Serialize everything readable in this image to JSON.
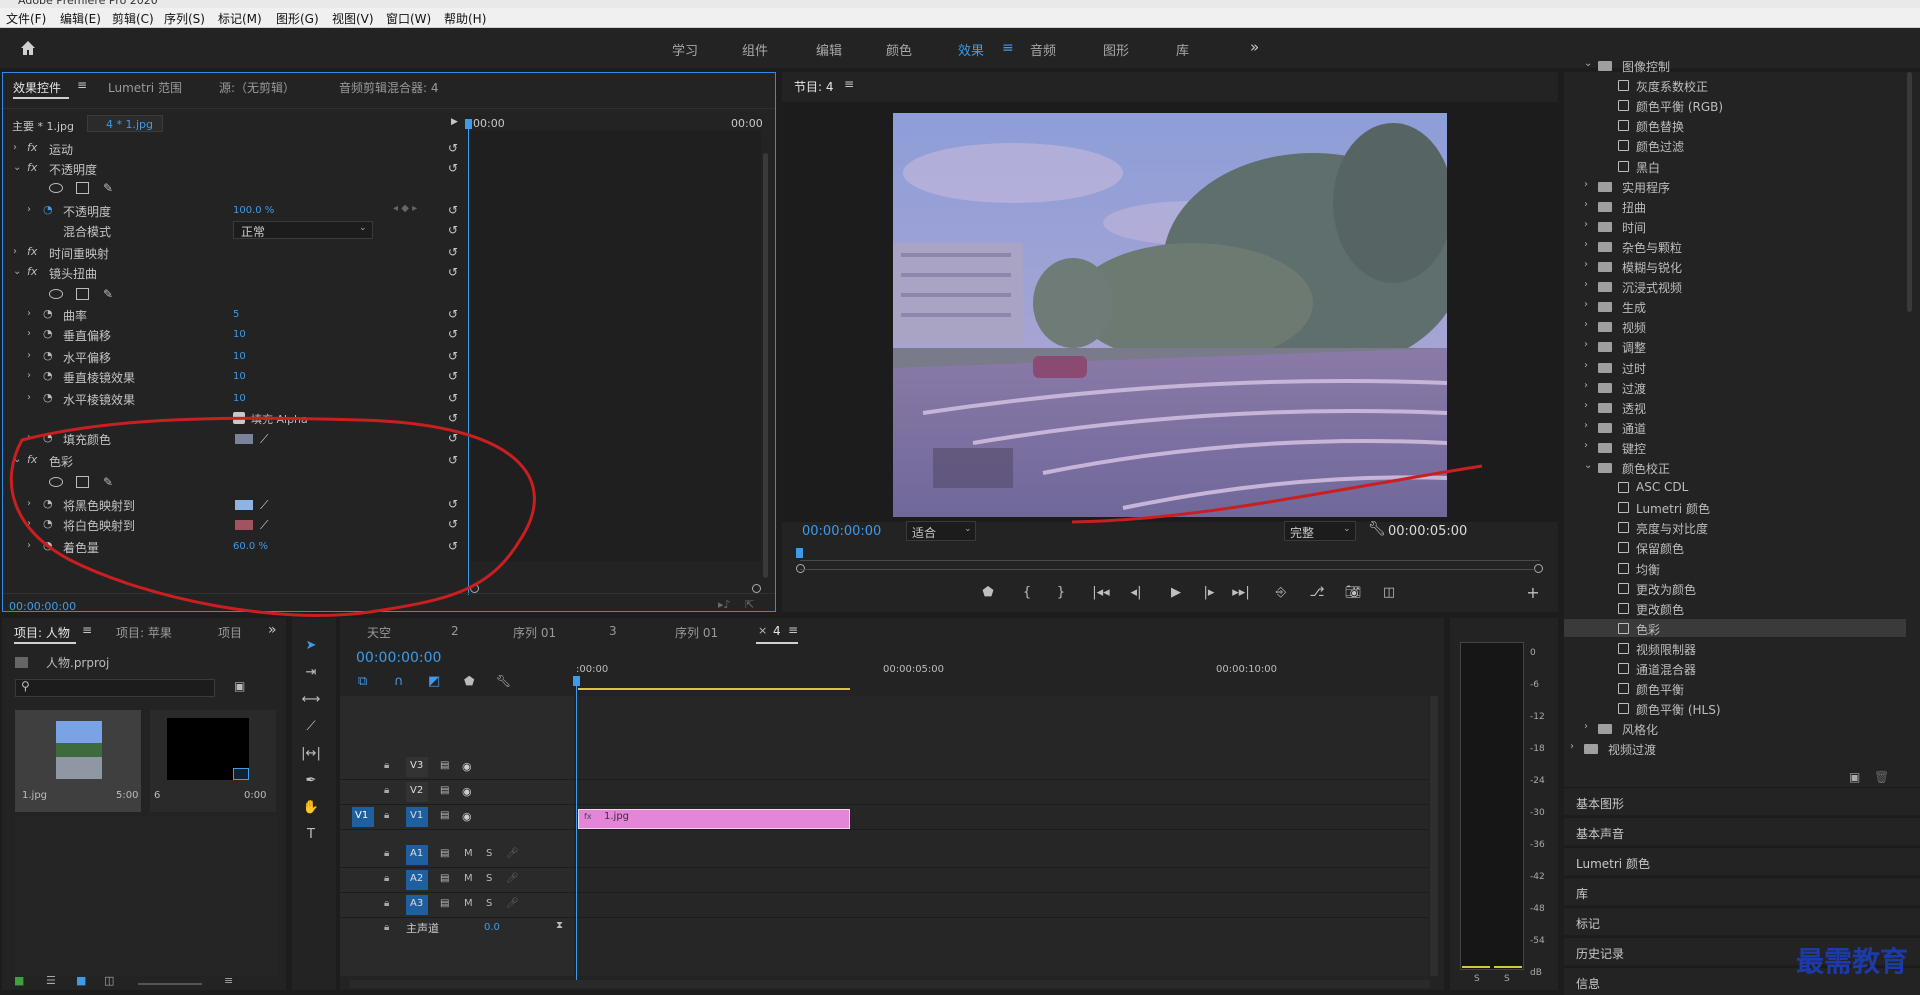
{
  "menu": [
    "文件(F)",
    "编辑(E)",
    "剪辑(C)",
    "序列(S)",
    "标记(M)",
    "图形(G)",
    "视图(V)",
    "窗口(W)",
    "帮助(H)"
  ],
  "workspaces": [
    "学习",
    "组件",
    "编辑",
    "颜色",
    "效果",
    "音频",
    "图形",
    "库"
  ],
  "active_workspace_index": 4,
  "effect_controls": {
    "tabs": [
      "效果控件",
      "Lumetri 范围",
      "源:（无剪辑）",
      "音频剪辑混合器: 4"
    ],
    "clip_master": "主要 * 1.jpg",
    "clip_seq": "4 * 1.jpg",
    "ruler_start": "00:00",
    "ruler_end": "00:00",
    "rows": [
      {
        "label": "运动",
        "indent": 1,
        "fx": true,
        "value": ""
      },
      {
        "label": "不透明度",
        "indent": 1,
        "fx": true,
        "value": ""
      },
      {
        "label": "不透明度",
        "indent": 2,
        "fx": false,
        "value": "100.0 %"
      },
      {
        "label": "混合模式",
        "indent": 3,
        "fx": false,
        "value": "正常"
      },
      {
        "label": "时间重映射",
        "indent": 1,
        "fx": true,
        "value": ""
      },
      {
        "label": "镜头扭曲",
        "indent": 1,
        "fx": true,
        "value": ""
      },
      {
        "label": "曲率",
        "indent": 2,
        "fx": false,
        "value": "5"
      },
      {
        "label": "垂直偏移",
        "indent": 2,
        "fx": false,
        "value": "10"
      },
      {
        "label": "水平偏移",
        "indent": 2,
        "fx": false,
        "value": "10"
      },
      {
        "label": "垂直棱镜效果",
        "indent": 2,
        "fx": false,
        "value": "10"
      },
      {
        "label": "水平棱镜效果",
        "indent": 2,
        "fx": false,
        "value": "10"
      },
      {
        "label": "填充 Alpha",
        "indent": 4,
        "fx": false,
        "value": ""
      },
      {
        "label": "填充颜色",
        "indent": 2,
        "fx": false,
        "value": ""
      },
      {
        "label": "色彩",
        "indent": 1,
        "fx": true,
        "value": ""
      },
      {
        "label": "将黑色映射到",
        "indent": 2,
        "fx": false,
        "value": ""
      },
      {
        "label": "将白色映射到",
        "indent": 2,
        "fx": false,
        "value": ""
      },
      {
        "label": "着色量",
        "indent": 2,
        "fx": false,
        "value": "60.0 %"
      }
    ],
    "timecode": "00:00:00:00",
    "colors": {
      "fill": "#7a8399",
      "black_map": "#8fb3e3",
      "white_map": "#a0545f"
    }
  },
  "program": {
    "title": "节目: 4",
    "timecode": "00:00:00:00",
    "fit": "适合",
    "quality": "完整",
    "duration": "00:00:05:00"
  },
  "effects_tree": [
    {
      "label": "图像控制",
      "type": "folder-open",
      "level": 1
    },
    {
      "label": "灰度系数校正",
      "type": "fx",
      "level": 2
    },
    {
      "label": "颜色平衡 (RGB)",
      "type": "fx",
      "level": 2
    },
    {
      "label": "颜色替换",
      "type": "fx",
      "level": 2
    },
    {
      "label": "颜色过滤",
      "type": "fx",
      "level": 2
    },
    {
      "label": "黑白",
      "type": "fx",
      "level": 2
    },
    {
      "label": "实用程序",
      "type": "folder",
      "level": 1
    },
    {
      "label": "扭曲",
      "type": "folder",
      "level": 1
    },
    {
      "label": "时间",
      "type": "folder",
      "level": 1
    },
    {
      "label": "杂色与颗粒",
      "type": "folder",
      "level": 1
    },
    {
      "label": "模糊与锐化",
      "type": "folder",
      "level": 1
    },
    {
      "label": "沉浸式视频",
      "type": "folder",
      "level": 1
    },
    {
      "label": "生成",
      "type": "folder",
      "level": 1
    },
    {
      "label": "视频",
      "type": "folder",
      "level": 1
    },
    {
      "label": "调整",
      "type": "folder",
      "level": 1
    },
    {
      "label": "过时",
      "type": "folder",
      "level": 1
    },
    {
      "label": "过渡",
      "type": "folder",
      "level": 1
    },
    {
      "label": "透视",
      "type": "folder",
      "level": 1
    },
    {
      "label": "通道",
      "type": "folder",
      "level": 1
    },
    {
      "label": "键控",
      "type": "folder",
      "level": 1
    },
    {
      "label": "颜色校正",
      "type": "folder-open",
      "level": 1
    },
    {
      "label": "ASC CDL",
      "type": "fx",
      "level": 2
    },
    {
      "label": "Lumetri 颜色",
      "type": "fx",
      "level": 2
    },
    {
      "label": "亮度与对比度",
      "type": "fx",
      "level": 2
    },
    {
      "label": "保留颜色",
      "type": "fx",
      "level": 2
    },
    {
      "label": "均衡",
      "type": "fx",
      "level": 2
    },
    {
      "label": "更改为颜色",
      "type": "fx",
      "level": 2
    },
    {
      "label": "更改颜色",
      "type": "fx",
      "level": 2
    },
    {
      "label": "色彩",
      "type": "fx",
      "level": 2,
      "selected": true
    },
    {
      "label": "视频限制器",
      "type": "fx",
      "level": 2
    },
    {
      "label": "通道混合器",
      "type": "fx",
      "level": 2
    },
    {
      "label": "颜色平衡",
      "type": "fx",
      "level": 2
    },
    {
      "label": "颜色平衡 (HLS)",
      "type": "fx",
      "level": 2
    },
    {
      "label": "风格化",
      "type": "folder",
      "level": 1
    },
    {
      "label": "视频过渡",
      "type": "folder",
      "level": 0
    }
  ],
  "side_panels": [
    "基本图形",
    "基本声音",
    "Lumetri 颜色",
    "库",
    "标记",
    "历史记录",
    "信息"
  ],
  "project": {
    "tabs": [
      "项目: 人物",
      "项目: 苹果",
      "项目"
    ],
    "file": "人物.prproj",
    "items": [
      {
        "name": "1.jpg",
        "dur": "5:00"
      },
      {
        "name": "6",
        "dur": "0:00"
      }
    ]
  },
  "timeline": {
    "tabs": [
      "天空",
      "2",
      "序列 01",
      "3",
      "序列 01",
      "4"
    ],
    "timecode": "00:00:00:00",
    "ruler": [
      ":00:00",
      "00:00:05:00",
      "00:00:10:00"
    ],
    "video_tracks": [
      "V3",
      "V2",
      "V1"
    ],
    "audio_tracks": [
      "A1",
      "A2",
      "A3"
    ],
    "master": "主声道",
    "master_val": "0.0",
    "clip_label": "1.jpg",
    "source_patch": "V1"
  },
  "meter_scale": [
    "0",
    "-6",
    "-12",
    "-18",
    "-24",
    "-30",
    "-36",
    "-42",
    "-48",
    "-54",
    "dB"
  ],
  "meter_solo": [
    "S",
    "S"
  ],
  "watermark": "最需教育"
}
